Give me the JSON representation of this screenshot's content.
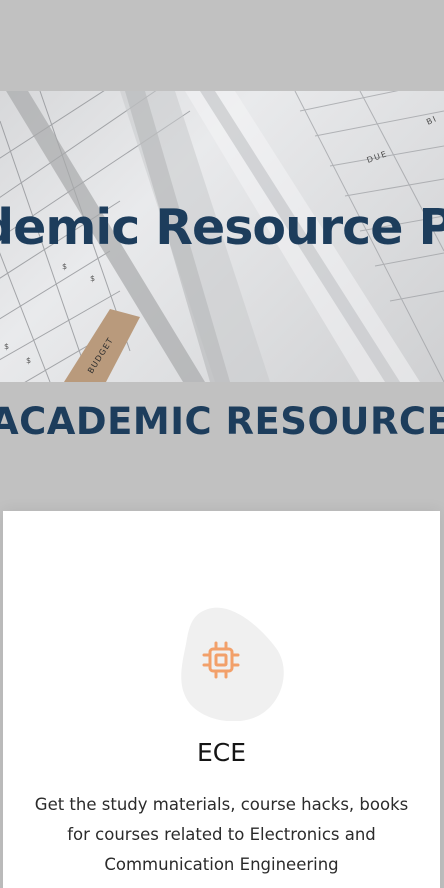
{
  "hero": {
    "title": "Academic Resource Portal",
    "image_labels": {
      "budget": "BUDGET",
      "due": "DUE",
      "bi": "BI"
    }
  },
  "section": {
    "heading": "ACADEMIC RESOURCES"
  },
  "card": {
    "icon": "chip-icon",
    "title": "ECE",
    "description": "Get the study materials, course hacks, books for courses related to Electronics and Communication Engineering"
  },
  "colors": {
    "background": "#c1c1c1",
    "heading": "#1d3d5c",
    "icon_accent": "#f2a06a",
    "blob": "#f0f0f0"
  }
}
